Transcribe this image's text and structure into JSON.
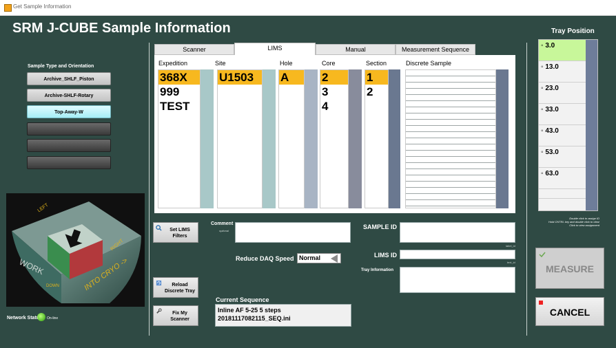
{
  "window": {
    "title": "Get Sample Information"
  },
  "app_title": "SRM J-CUBE Sample Information",
  "sample_type": {
    "label": "Sample Type and Orientation",
    "buttons": [
      {
        "label": "Archive_SHLF_Piston",
        "state": "normal"
      },
      {
        "label": "Archive-SHLF-Rotary",
        "state": "normal"
      },
      {
        "label": "Top-Away-W",
        "state": "selected"
      },
      {
        "label": "",
        "state": "disabled"
      },
      {
        "label": "",
        "state": "disabled"
      },
      {
        "label": "",
        "state": "disabled"
      }
    ]
  },
  "cryo_image": {
    "labels": [
      "LEFT",
      "RIGHT",
      "WORK",
      "DOWN",
      "INTO CRYO ->"
    ]
  },
  "network": {
    "label": "Network Status",
    "state": "On-line",
    "color": "#2fb80a"
  },
  "tabs": [
    {
      "label": "Scanner",
      "active": false
    },
    {
      "label": "LIMS",
      "active": true
    },
    {
      "label": "Manual",
      "active": false
    },
    {
      "label": "Measurement Sequence",
      "active": false
    }
  ],
  "lims": {
    "columns": [
      "Expedition",
      "Site",
      "Hole",
      "Core",
      "Section",
      "Discrete Sample"
    ],
    "expedition": [
      "368X",
      "999",
      "TEST"
    ],
    "site": [
      "U1503"
    ],
    "hole": [
      "A"
    ],
    "core": [
      "2",
      "3",
      "4"
    ],
    "section": [
      "1",
      "2"
    ],
    "selected_color": "#f7b81f"
  },
  "buttons": {
    "set_lims_filters": "Set LIMS Filters",
    "reload_discrete_tray": "Reload Discrete Tray",
    "fix_my_scanner": "Fix My Scanner",
    "measure": "MEASURE",
    "cancel": "CANCEL"
  },
  "form": {
    "comment_label": "Comment",
    "comment_sub": "optional",
    "comment_value": "",
    "reduce_daq_label": "Reduce DAQ Speed",
    "reduce_daq_value": "Normal",
    "sample_id_label": "SAMPLE ID",
    "sample_id_value": "",
    "sample_id_tag": "label_id",
    "lims_id_label": "LIMS ID",
    "lims_id_value": "",
    "lims_id_tag": "text_id",
    "tray_info_label": "Tray Information",
    "tray_info_value": ""
  },
  "current_sequence": {
    "label": "Current Sequence",
    "line1": "Inline AF 5-25 5 steps",
    "line2": "20181117082115_SEQ.ini"
  },
  "tray": {
    "header": "Tray Position",
    "positions": [
      "3.0",
      "13.0",
      "23.0",
      "33.0",
      "43.0",
      "53.0",
      "63.0"
    ],
    "selected": "3.0",
    "note_1": "Double click to assign ID",
    "note_2": "Hold CNTRL key and double click to clear",
    "note_3": "Click to view assignment"
  }
}
